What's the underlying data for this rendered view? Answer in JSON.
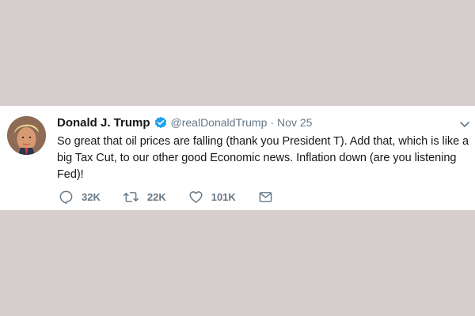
{
  "tweet": {
    "display_name": "Donald J. Trump",
    "handle": "@realDonaldTrump",
    "separator": "·",
    "date": "Nov 25",
    "text": "So great that oil prices are falling (thank you President T). Add that, which is like a big Tax Cut, to our other good Economic news. Inflation down (are you listening Fed)!",
    "avatar_icon": "profile-photo",
    "verified_icon": "verified-badge-icon",
    "actions": {
      "replies": "32K",
      "retweets": "22K",
      "likes": "101K"
    }
  },
  "colors": {
    "background": "#d6cdcd",
    "card": "#ffffff",
    "verified": "#1da1f2",
    "secondary_text": "#657786",
    "primary_text": "#14171a"
  }
}
